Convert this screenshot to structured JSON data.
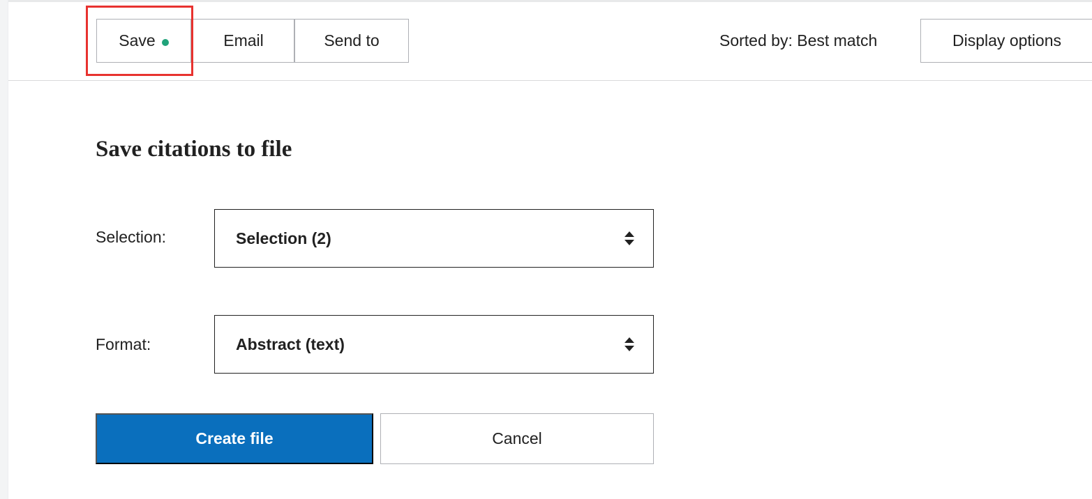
{
  "toolbar": {
    "save_label": "Save",
    "email_label": "Email",
    "send_to_label": "Send to",
    "sorted_by_text": "Sorted by: Best match",
    "display_options_label": "Display options",
    "save_dot_color": "#20a37a",
    "highlight_color": "#e8322f"
  },
  "dialog": {
    "title": "Save citations to file",
    "selection": {
      "label": "Selection:",
      "value": "Selection (2)",
      "icon": "sort-arrows-icon"
    },
    "format": {
      "label": "Format:",
      "value": "Abstract (text)",
      "icon": "sort-arrows-icon"
    },
    "create_label": "Create file",
    "cancel_label": "Cancel",
    "accent_color": "#0a6fbd"
  }
}
